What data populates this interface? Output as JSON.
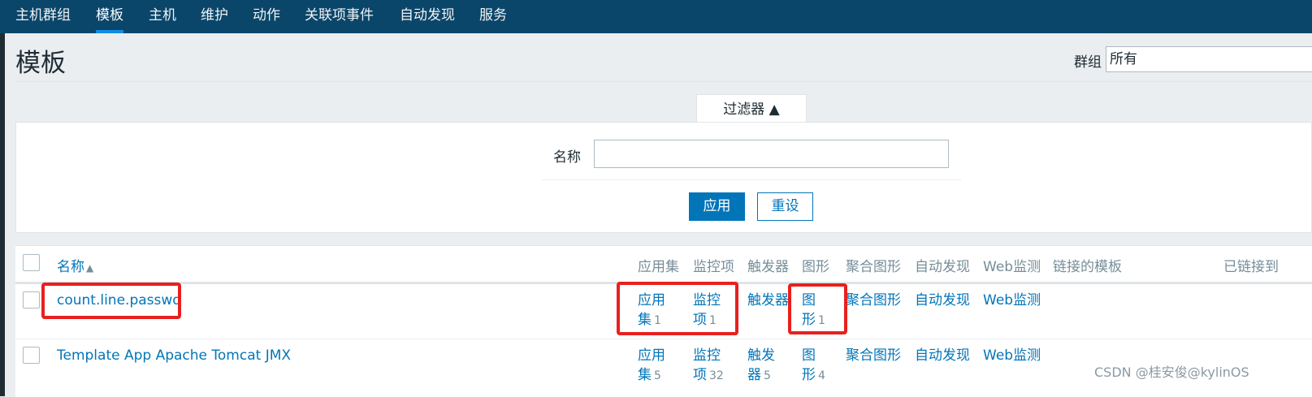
{
  "nav": {
    "items": [
      "主机群组",
      "模板",
      "主机",
      "维护",
      "动作",
      "关联项事件",
      "自动发现",
      "服务"
    ],
    "active_index": 1
  },
  "page": {
    "title": "模板",
    "group_label": "群组",
    "group_value": "所有"
  },
  "filter": {
    "tab_label": "过滤器 ▲",
    "name_label": "名称",
    "name_value": "",
    "apply_label": "应用",
    "reset_label": "重设"
  },
  "table": {
    "columns": {
      "name": "名称",
      "sort_icon": "▲",
      "applications": "应用集",
      "items": "监控项",
      "triggers": "触发器",
      "graphs": "图形",
      "screens": "聚合图形",
      "discovery": "自动发现",
      "web": "Web监测",
      "linked_templates": "链接的模板",
      "linked_to": "已链接到"
    },
    "rows": [
      {
        "name": "count.line.passwd",
        "app_1": "应用",
        "app_2": "集",
        "app_count": "1",
        "items_1": "监控",
        "items_2": "项",
        "items_count": "1",
        "triggers_1": "触发器",
        "triggers_2": "",
        "triggers_count": "",
        "graphs_1": "图",
        "graphs_2": "形",
        "graphs_count": "1",
        "screens": "聚合图形",
        "discovery": "自动发现",
        "web": "Web监测"
      },
      {
        "name": "Template App Apache Tomcat JMX",
        "app_1": "应用",
        "app_2": "集",
        "app_count": "5",
        "items_1": "监控",
        "items_2": "项",
        "items_count": "32",
        "triggers_1": "触发",
        "triggers_2": "器",
        "triggers_count": "5",
        "graphs_1": "图",
        "graphs_2": "形",
        "graphs_count": "4",
        "screens": "聚合图形",
        "discovery": "自动发现",
        "web": "Web监测"
      }
    ]
  },
  "watermark": "CSDN @桂安俊@kylinOS",
  "colors": {
    "nav_bg": "#0a466a",
    "link": "#0275b8",
    "highlight_border": "#e8201e",
    "page_bg": "#ebeef0"
  }
}
